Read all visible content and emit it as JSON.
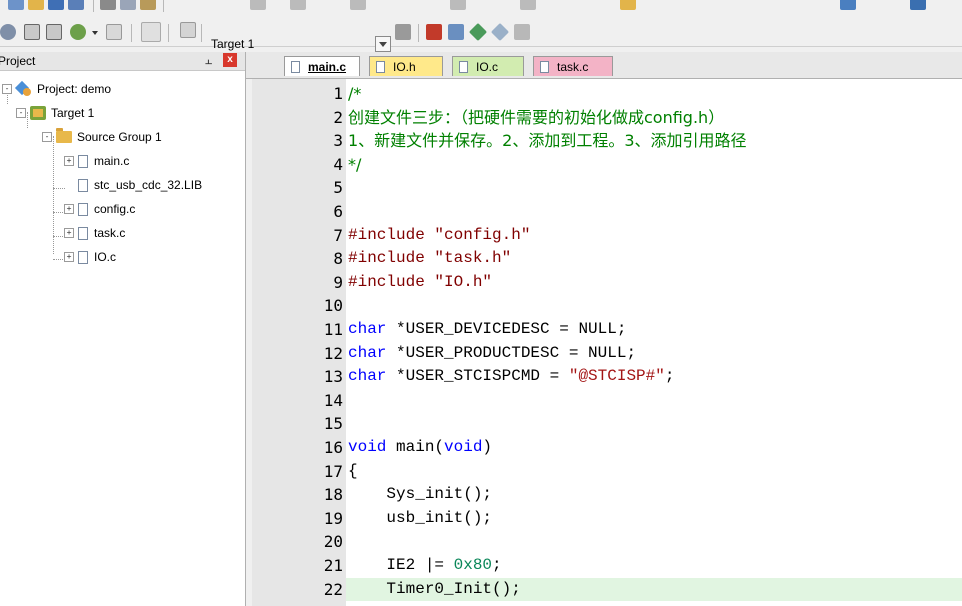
{
  "toolbar": {
    "target_label": "Target 1"
  },
  "project_panel": {
    "title": "Project",
    "tree": [
      {
        "label": "Project: demo",
        "type": "project",
        "level": 0,
        "expand": "-"
      },
      {
        "label": "Target 1",
        "type": "target",
        "level": 1,
        "expand": "-"
      },
      {
        "label": "Source Group 1",
        "type": "folder",
        "level": 2,
        "expand": "-"
      },
      {
        "label": "main.c",
        "type": "file",
        "level": 3,
        "expand": "+"
      },
      {
        "label": "stc_usb_cdc_32.LIB",
        "type": "file",
        "level": 3,
        "expand": ""
      },
      {
        "label": "config.c",
        "type": "file",
        "level": 3,
        "expand": "+"
      },
      {
        "label": "task.c",
        "type": "file",
        "level": 3,
        "expand": "+"
      },
      {
        "label": "IO.c",
        "type": "file",
        "level": 3,
        "expand": "+"
      }
    ]
  },
  "tabs": [
    {
      "label": "main.c",
      "color": "#ffffff",
      "active": true
    },
    {
      "label": "IO.h",
      "color": "#ffe98a",
      "active": false
    },
    {
      "label": "IO.c",
      "color": "#d2ecb0",
      "active": false
    },
    {
      "label": "task.c",
      "color": "#f3b3c6",
      "active": false
    }
  ],
  "editor": {
    "highlight_line": 22,
    "lines": [
      {
        "n": "1",
        "parts": [
          {
            "t": "/*",
            "c": "comment"
          }
        ]
      },
      {
        "n": "2",
        "parts": [
          {
            "t": "创建文件三步：（把硬件需要的初始化做成config.h）",
            "c": "comment"
          }
        ]
      },
      {
        "n": "3",
        "parts": [
          {
            "t": "1、新建文件并保存。2、添加到工程。3、添加引用路径",
            "c": "comment"
          }
        ]
      },
      {
        "n": "4",
        "parts": [
          {
            "t": "*/",
            "c": "comment"
          }
        ]
      },
      {
        "n": "5",
        "parts": []
      },
      {
        "n": "6",
        "parts": []
      },
      {
        "n": "7",
        "parts": [
          {
            "t": "#include ",
            "c": "pre"
          },
          {
            "t": "\"config.h\"",
            "c": "str2"
          }
        ]
      },
      {
        "n": "8",
        "parts": [
          {
            "t": "#include ",
            "c": "pre"
          },
          {
            "t": "\"task.h\"",
            "c": "str2"
          }
        ]
      },
      {
        "n": "9",
        "parts": [
          {
            "t": "#include ",
            "c": "pre"
          },
          {
            "t": "\"IO.h\"",
            "c": "str2"
          }
        ]
      },
      {
        "n": "10",
        "parts": []
      },
      {
        "n": "11",
        "parts": [
          {
            "t": "char",
            "c": "kw"
          },
          {
            "t": " *USER_DEVICEDESC = NULL;",
            "c": ""
          }
        ]
      },
      {
        "n": "12",
        "parts": [
          {
            "t": "char",
            "c": "kw"
          },
          {
            "t": " *USER_PRODUCTDESC = NULL;",
            "c": ""
          }
        ]
      },
      {
        "n": "13",
        "parts": [
          {
            "t": "char",
            "c": "kw"
          },
          {
            "t": " *USER_STCISPCMD = ",
            "c": ""
          },
          {
            "t": "\"@STCISP#\"",
            "c": "str"
          },
          {
            "t": ";",
            "c": ""
          }
        ]
      },
      {
        "n": "14",
        "parts": []
      },
      {
        "n": "15",
        "parts": []
      },
      {
        "n": "16",
        "parts": [
          {
            "t": "void",
            "c": "kw"
          },
          {
            "t": " main(",
            "c": ""
          },
          {
            "t": "void",
            "c": "kw"
          },
          {
            "t": ")",
            "c": ""
          }
        ]
      },
      {
        "n": "17",
        "parts": [
          {
            "t": "{",
            "c": ""
          }
        ]
      },
      {
        "n": "18",
        "parts": [
          {
            "t": "    Sys_init();",
            "c": ""
          }
        ]
      },
      {
        "n": "19",
        "parts": [
          {
            "t": "    usb_init();",
            "c": ""
          }
        ]
      },
      {
        "n": "20",
        "parts": []
      },
      {
        "n": "21",
        "parts": [
          {
            "t": "    IE2 |= ",
            "c": ""
          },
          {
            "t": "0x80",
            "c": "num"
          },
          {
            "t": ";",
            "c": ""
          }
        ]
      },
      {
        "n": "22",
        "parts": [
          {
            "t": "    Timer0_Init();",
            "c": ""
          }
        ]
      }
    ]
  }
}
